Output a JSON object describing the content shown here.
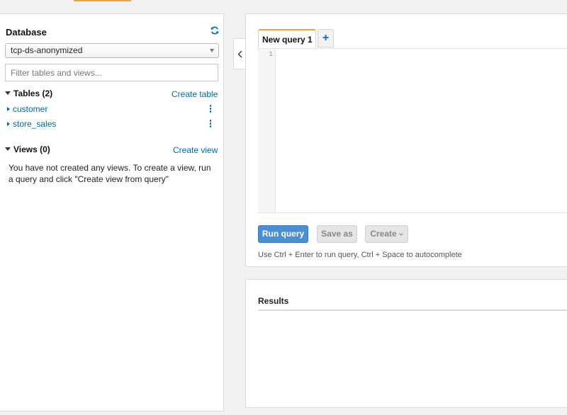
{
  "left_panel": {
    "title": "Database",
    "refresh_icon": "refresh-icon",
    "database_select": {
      "selected": "tcp-ds-anonymized"
    },
    "filter_placeholder": "Filter tables and views...",
    "tables": {
      "header": "Tables (2)",
      "create_link": "Create table",
      "items": [
        {
          "name": "customer",
          "menu_icon": "kebab-icon"
        },
        {
          "name": "store_sales",
          "menu_icon": "kebab-icon"
        }
      ]
    },
    "views": {
      "header": "Views (0)",
      "create_link": "Create view",
      "empty_message": "You have not created any views. To create a view, run a query and click \"Create view from query\""
    }
  },
  "collapse_icon": "chevron-left-icon",
  "editor": {
    "tabs": [
      {
        "label": "New query 1",
        "active": true
      }
    ],
    "add_tab_label": "+",
    "line_numbers": [
      "1"
    ],
    "buttons": {
      "run": "Run query",
      "save_as": "Save as",
      "create": "Create"
    },
    "hint": "Use Ctrl + Enter to run query, Ctrl + Space to autocomplete"
  },
  "results": {
    "title": "Results"
  },
  "colors": {
    "accent_orange": "#f0a04b",
    "link_blue": "#0066aa",
    "primary_button": "#4b8fd0",
    "background": "#f1f1f1"
  }
}
